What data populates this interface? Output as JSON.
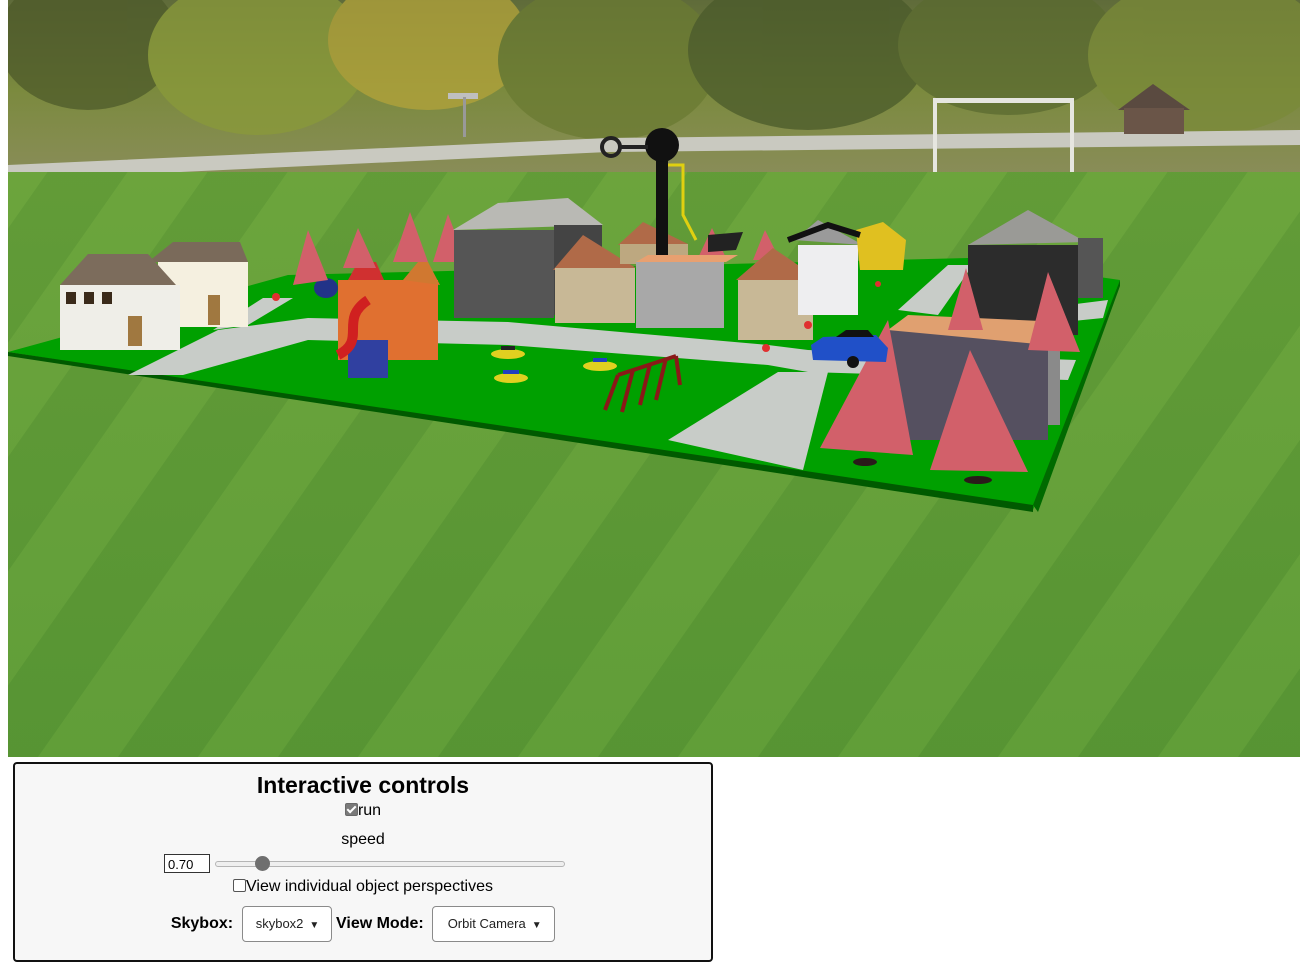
{
  "scene": {
    "description_icon": "3d-town-scene",
    "colors": {
      "ground": "#00a000",
      "road": "#c8ccc8",
      "tree": "#d2606a",
      "lawn": "#5b9a3a",
      "forest": "#7a8a3a"
    }
  },
  "controls": {
    "title": "Interactive controls",
    "run": {
      "label": "run",
      "checked": true
    },
    "speed": {
      "label": "speed",
      "value": "0.70",
      "fraction": 0.12
    },
    "perspectives": {
      "label": "View individual object perspectives",
      "checked": false
    },
    "skybox": {
      "label": "Skybox:",
      "selected": "skybox2"
    },
    "view_mode": {
      "label": "View Mode:",
      "selected": "Orbit Camera"
    }
  }
}
